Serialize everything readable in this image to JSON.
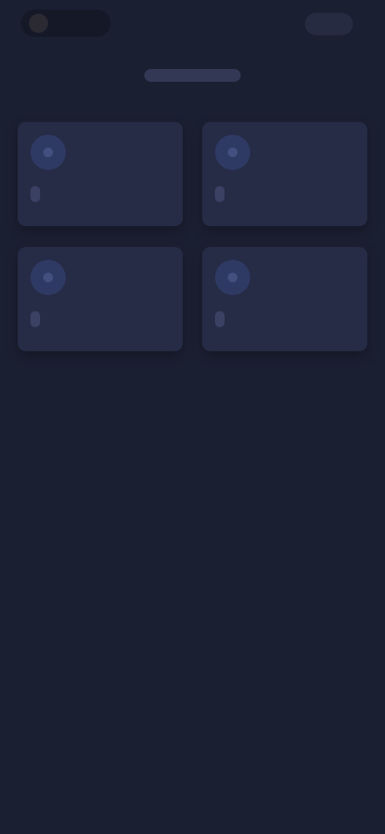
{
  "header": {
    "logo_text": "",
    "action_label": ""
  },
  "page_title": "",
  "cards": [
    {
      "label": "",
      "icon": "circle-icon"
    },
    {
      "label": "",
      "icon": "circle-icon"
    },
    {
      "label": "",
      "icon": "circle-icon"
    },
    {
      "label": "",
      "icon": "circle-icon"
    }
  ],
  "colors": {
    "background": "#1b1f32",
    "card": "#262b46",
    "icon": "#2e3a63",
    "label": "#3a4163"
  }
}
